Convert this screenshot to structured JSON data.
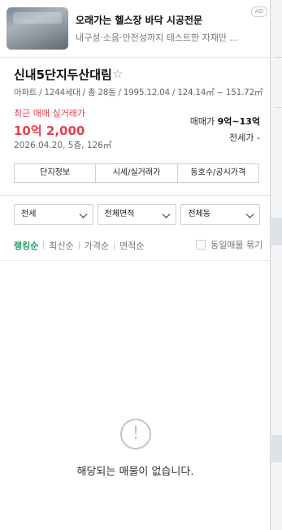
{
  "ad": {
    "title": "오래가는 헬스장 바닥 시공전문",
    "description": "내구성·소음·안전성까지 테스트한 자재만 ...",
    "badge": "AD"
  },
  "complex": {
    "name": "신내5단지두산대림",
    "meta": "아파트 / 1244세대 / 총 28동 / 1995.12.04 / 124.14㎡ ~ 151.72㎡",
    "recent_label": "최근 매매 실거래가",
    "recent_price": "10억 2,000",
    "recent_detail": "2026.04.20, 5층, 126㎡",
    "sale_label": "매매가",
    "sale_value": "9억~13억",
    "lease_label": "전세가",
    "lease_value": "-"
  },
  "buttons": [
    "단지정보",
    "시세/실거래가",
    "동호수/공시가격"
  ],
  "filters": [
    "전세",
    "전체면적",
    "전체동"
  ],
  "sort": {
    "options": [
      "랭킹순",
      "최신순",
      "가격순",
      "면적순"
    ],
    "active": "랭킹순",
    "bundle_label": "동일매물 묶기"
  },
  "empty": {
    "icon": "exclamation-icon",
    "message": "해당되는 매물이 없습니다."
  },
  "colors": {
    "accent_red": "#e8404c",
    "accent_green": "#1ea563"
  }
}
